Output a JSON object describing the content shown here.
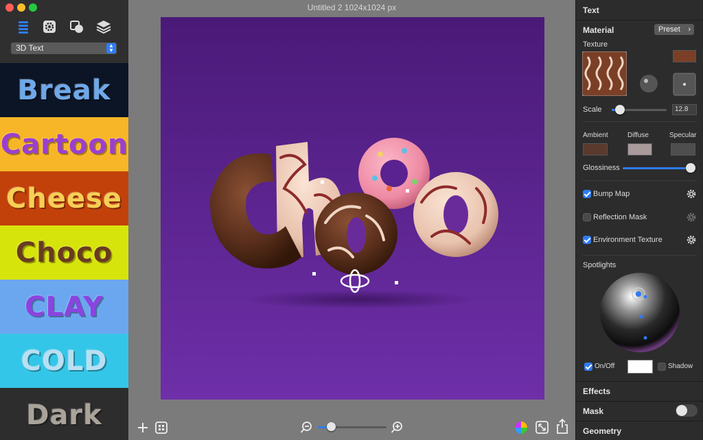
{
  "window": {
    "title": "Untitled 2 1024x1024 px"
  },
  "sidebar": {
    "toolbar_icons": [
      "list-icon",
      "gear-icon",
      "shapes-icon",
      "layers-icon"
    ],
    "preset_select": {
      "value": "3D Text"
    },
    "styles": [
      {
        "label": "Break",
        "bg": "#0b1526",
        "color": "#6fa8e8"
      },
      {
        "label": "Cartoon",
        "bg": "#f6b628",
        "color": "#9b3fcf"
      },
      {
        "label": "Cheese",
        "bg": "#c2410a",
        "color": "#f7cf55"
      },
      {
        "label": "Choco",
        "bg": "#d7e40c",
        "color": "#6a3a1f"
      },
      {
        "label": "CLAY",
        "bg": "#6ba7ef",
        "color": "#8b44e0"
      },
      {
        "label": "COLD",
        "bg": "#34c6e8",
        "color": "#b9dff2"
      },
      {
        "label": "Dark",
        "bg": "#2d2d2d",
        "color": "#a9a39a"
      }
    ]
  },
  "canvas": {
    "text": "Choco",
    "bg_top": "#4a1a78",
    "bg_bottom": "#6e2fa8"
  },
  "bottom_bar": {
    "zoom": 0.2,
    "icons": [
      "add-icon",
      "grid-icon",
      "zoom-out-icon",
      "zoom-in-icon",
      "color-wheel-icon",
      "resize-icon",
      "share-icon"
    ]
  },
  "inspector": {
    "section_text": "Text",
    "material_label": "Material",
    "preset_button": "Preset",
    "texture_label": "Texture",
    "scale_label": "Scale",
    "scale_value": "12.8",
    "scale": 0.15,
    "ambient_label": "Ambient",
    "diffuse_label": "Diffuse",
    "specular_label": "Specular",
    "ambient_color": "#5a3a2c",
    "diffuse_color": "#a99a9c",
    "specular_color": "#4e4e4e",
    "texture_color": "#7a3f26",
    "glossiness_label": "Glossiness",
    "glossiness": 0.95,
    "bump_map_label": "Bump Map",
    "bump_map": true,
    "reflection_mask_label": "Reflection Mask",
    "reflection_mask": false,
    "environment_texture_label": "Environment Texture",
    "environment_texture": true,
    "spotlights_label": "Spotlights",
    "onoff_label": "On/Off",
    "onoff": true,
    "light_color": "#ffffff",
    "shadow_label": "Shadow",
    "shadow": false,
    "effects_label": "Effects",
    "mask_label": "Mask",
    "mask_toggle": false,
    "geometry_label": "Geometry",
    "accent_color": "#2e7cf6"
  }
}
